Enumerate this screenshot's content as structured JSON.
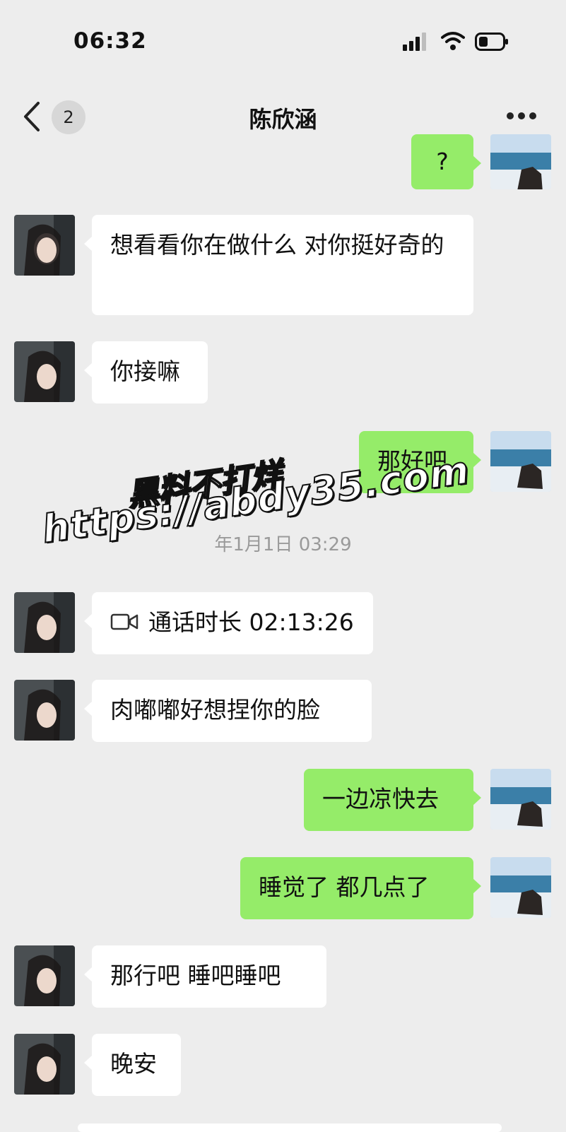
{
  "status_bar": {
    "time": "06:32",
    "signal_icon": "signal-bars-icon",
    "wifi_icon": "wifi-icon",
    "battery_icon": "battery-icon"
  },
  "nav": {
    "back_icon": "chevron-left-icon",
    "unread_count": "2",
    "title": "陈欣涵",
    "more_icon": "more-dots-icon"
  },
  "messages": [
    {
      "side": "right",
      "text": "?"
    },
    {
      "side": "left",
      "text": "想看看你在做什么 对你挺好奇的"
    },
    {
      "side": "left",
      "text": "你接嘛"
    },
    {
      "side": "right",
      "text": "那好吧"
    },
    {
      "type": "call",
      "side": "left",
      "icon": "video-call-icon",
      "text": "通话时长 02:13:26"
    },
    {
      "side": "left",
      "text": "肉嘟嘟好想捏你的脸"
    },
    {
      "side": "right",
      "text": "一边凉快去"
    },
    {
      "side": "right",
      "text": "睡觉了 都几点了"
    },
    {
      "side": "left",
      "text": "那行吧 睡吧睡吧"
    },
    {
      "side": "left",
      "text": "晚安"
    }
  ],
  "timestamp": "年1月1日 03:29",
  "watermark": {
    "line1": "黑料不打烊",
    "line2": "https://abdy35.com"
  },
  "colors": {
    "background": "#ededed",
    "sent_bubble": "#95ec69",
    "received_bubble": "#ffffff"
  }
}
